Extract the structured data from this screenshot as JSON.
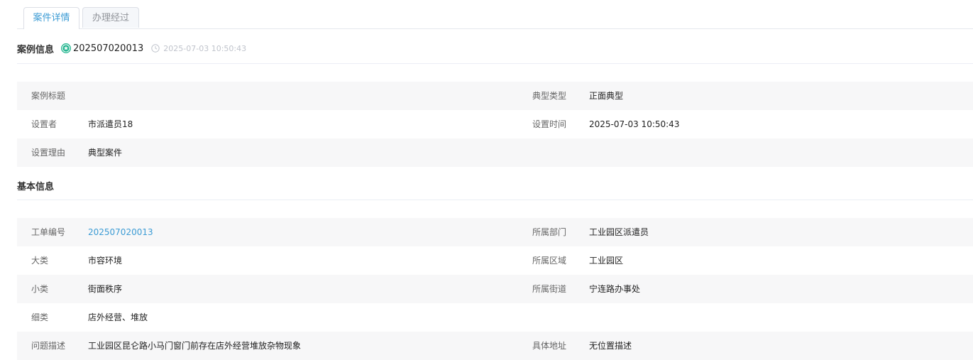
{
  "tabs": [
    {
      "label": "案件详情",
      "active": true
    },
    {
      "label": "办理经过",
      "active": false
    }
  ],
  "case_info": {
    "title": "案例信息",
    "case_id": "202507020013",
    "timestamp": "2025-07-03 10:50:43",
    "rows": [
      {
        "label1": "案例标题",
        "value1": "",
        "label2": "典型类型",
        "value2": "正面典型"
      },
      {
        "label1": "设置者",
        "value1": "市派遣员18",
        "label2": "设置时间",
        "value2": "2025-07-03 10:50:43"
      },
      {
        "label1": "设置理由",
        "value1": "典型案件",
        "label2": "",
        "value2": ""
      }
    ]
  },
  "basic_info": {
    "title": "基本信息",
    "rows": [
      {
        "label1": "工单编号",
        "value1": "202507020013",
        "label2": "所属部门",
        "value2": "工业园区派遣员"
      },
      {
        "label1": "大类",
        "value1": "市容环境",
        "label2": "所属区域",
        "value2": "工业园区"
      },
      {
        "label1": "小类",
        "value1": "街面秩序",
        "label2": "所属街道",
        "value2": "宁连路办事处"
      },
      {
        "label1": "细类",
        "value1": "店外经营、堆放",
        "label2": "",
        "value2": ""
      },
      {
        "label1": "问题描述",
        "value1": "工业园区昆仑路小马门窗门前存在店外经营堆放杂物现象",
        "label2": "具体地址",
        "value2": "无位置描述"
      }
    ]
  },
  "colors": {
    "accent": "#3b9bd4",
    "star_badge": "#1fb48d",
    "stripe": "#f7f7f8",
    "muted": "#c0c4cc"
  }
}
